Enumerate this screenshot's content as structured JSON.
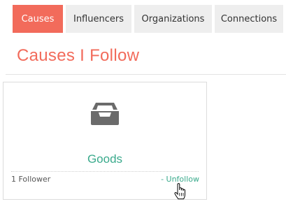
{
  "tabs": [
    {
      "label": "Causes",
      "active": true
    },
    {
      "label": "Influencers",
      "active": false
    },
    {
      "label": "Organizations",
      "active": false
    },
    {
      "label": "Connections",
      "active": false
    }
  ],
  "page": {
    "title": "Causes I Follow"
  },
  "cards": [
    {
      "name": "Goods",
      "icon": "inbox-icon",
      "followers": "1 Follower",
      "action": "- Unfollow"
    }
  ],
  "colors": {
    "accent": "#f26b5b",
    "green": "#3aaa8c",
    "tab_inactive_bg": "#eeeeee",
    "icon_gray": "#6b6b6b"
  }
}
